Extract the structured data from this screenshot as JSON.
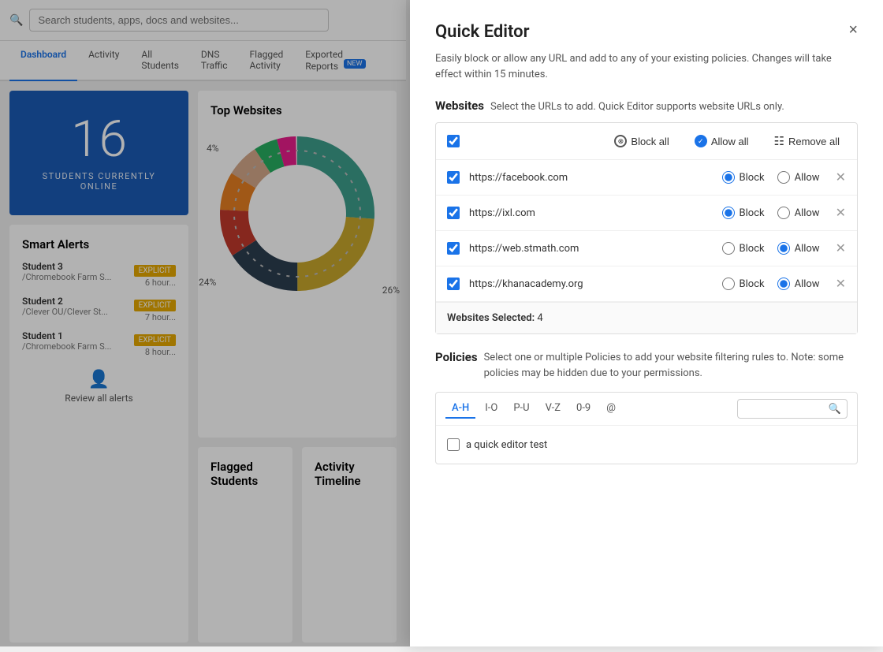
{
  "app": {
    "search_placeholder": "Search students, apps, docs and websites..."
  },
  "tabs": [
    {
      "id": "dashboard",
      "label": "Dashboard",
      "active": true
    },
    {
      "id": "activity",
      "label": "Activity",
      "active": false
    },
    {
      "id": "all-students",
      "label": "All Students",
      "active": false
    },
    {
      "id": "dns-traffic",
      "label": "DNS Traffic",
      "active": false
    },
    {
      "id": "flagged-activity",
      "label": "Flagged Activity",
      "active": false
    },
    {
      "id": "exported-reports",
      "label": "Exported Reports",
      "active": false,
      "badge": "NEW"
    }
  ],
  "students_card": {
    "count": "16",
    "label": "STUDENTS CURRENTLY ONLINE"
  },
  "smart_alerts": {
    "title": "Smart Alerts",
    "items": [
      {
        "student": "Student 3",
        "path": "/Chromebook Farm S...",
        "badge": "EXPLICIT",
        "time": "6 hour..."
      },
      {
        "student": "Student 2",
        "path": "/Clever OU/Clever St...",
        "badge": "EXPLICIT",
        "time": "7 hour..."
      },
      {
        "student": "Student 1",
        "path": "/Chromebook Farm S...",
        "badge": "EXPLICIT",
        "time": "8 hour..."
      }
    ],
    "review_label": "Review all alerts"
  },
  "top_websites": {
    "title": "Top Websites",
    "chart_labels": [
      {
        "value": "4%",
        "position": "top-left"
      },
      {
        "value": "24%",
        "position": "bottom-left"
      },
      {
        "value": "26%",
        "position": "bottom-right"
      }
    ]
  },
  "bottom_cards": [
    {
      "title": "Flagged Students"
    },
    {
      "title": "Activity Timeline"
    }
  ],
  "quick_editor": {
    "title": "Quick Editor",
    "subtitle": "Easily block or allow any URL and add to any of your existing policies. Changes will take effect within 15 minutes.",
    "close_label": "×",
    "websites_section": {
      "label": "Websites",
      "description": "Select the URLs to add. Quick Editor supports website URLs only.",
      "toolbar": {
        "block_all": "Block all",
        "allow_all": "Allow all",
        "remove_all": "Remove all"
      },
      "rows": [
        {
          "id": "fb",
          "url": "https://facebook.com",
          "block": true,
          "allow": false
        },
        {
          "id": "ixl",
          "url": "https://ixl.com",
          "block": true,
          "allow": false
        },
        {
          "id": "stmath",
          "url": "https://web.stmath.com",
          "block": false,
          "allow": true
        },
        {
          "id": "khan",
          "url": "https://khanacademy.org",
          "block": false,
          "allow": true
        }
      ],
      "footer": {
        "label": "Websites Selected:",
        "count": "4"
      }
    },
    "policies_section": {
      "label": "Policies",
      "description": "Select one or multiple Policies to add your website filtering rules to. Note: some policies may be hidden due to your permissions.",
      "tabs": [
        {
          "id": "a-h",
          "label": "A-H",
          "active": true
        },
        {
          "id": "i-o",
          "label": "I-O",
          "active": false
        },
        {
          "id": "p-u",
          "label": "P-U",
          "active": false
        },
        {
          "id": "v-z",
          "label": "V-Z",
          "active": false
        },
        {
          "id": "0-9",
          "label": "0-9",
          "active": false
        },
        {
          "id": "at",
          "label": "@",
          "active": false
        }
      ],
      "search_placeholder": "",
      "items": [
        {
          "name": "a quick editor test",
          "checked": false
        }
      ]
    }
  }
}
